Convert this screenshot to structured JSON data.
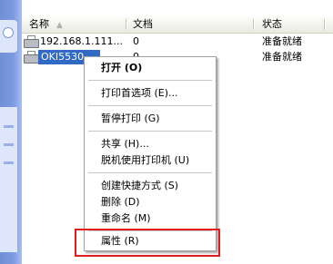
{
  "header": {
    "name": "名称",
    "doc": "文档",
    "status": "状态"
  },
  "rows": [
    {
      "name": "192.168.1.111...",
      "doc": "0",
      "status": "准备就绪"
    },
    {
      "name": "OKI5530-...",
      "doc": "0",
      "status": "准备就绪"
    }
  ],
  "menu": [
    {
      "label": "打开 (O)"
    },
    {
      "label": "打印首选项 (E)..."
    },
    {
      "label": "暂停打印 (G)"
    },
    {
      "label": "共享 (H)..."
    },
    {
      "label": "脱机使用打印机 (U)"
    },
    {
      "label": "创建快捷方式 (S)"
    },
    {
      "label": "删除 (D)"
    },
    {
      "label": "重命名 (M)"
    },
    {
      "label": "属性 (R)"
    }
  ],
  "colors": {
    "selection": "#316ac5",
    "highlight_box": "#e41b1b"
  },
  "icons": {
    "printer": "printer-icon",
    "sort": "sort-ascending-icon"
  }
}
